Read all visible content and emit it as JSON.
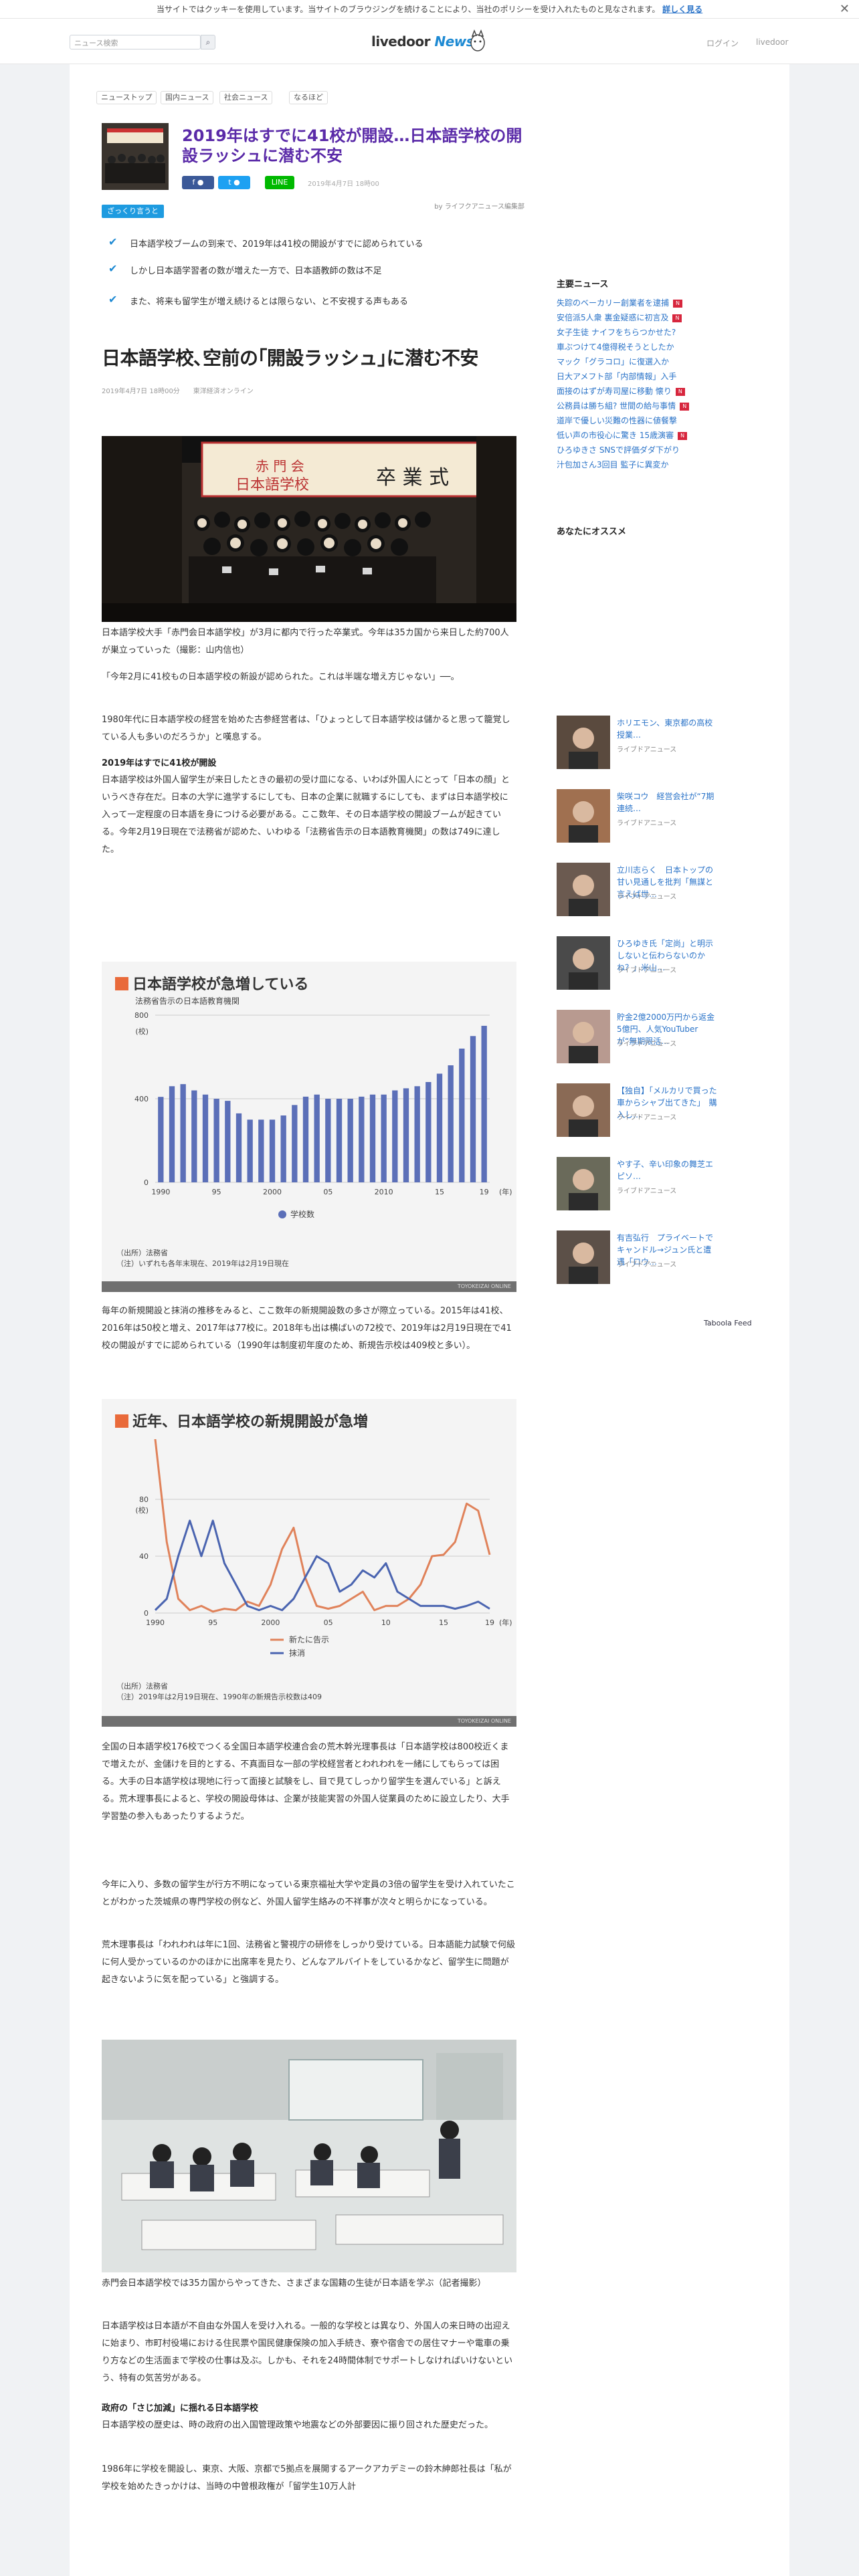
{
  "cookie": {
    "text": "当サイトではクッキーを使用しています。当サイトのブラウジングを続けることにより、当社のポリシーを受け入れたものと見なされます。",
    "link": "詳しく見る",
    "close": "✕"
  },
  "header": {
    "search_placeholder": "ニュース検索",
    "logo_main": "livedoor",
    "logo_sub": "News",
    "login": "ログイン",
    "livedoor": "livedoor"
  },
  "breadcrumb": [
    "ニューストップ",
    "国内ニュース",
    "社会ニュース",
    "なるほど"
  ],
  "article": {
    "title": "2019年はすでに41校が開設…日本語学校の開設ラッシュに潜む不安",
    "share": {
      "facebook": "f ●",
      "twitter": "t ●",
      "line": "LINE"
    },
    "date": "2019年4月7日 18時00",
    "byline": "by ライフクアニュース編集部",
    "tag": "ざっくり言うと",
    "points": [
      "日本語学校ブームの到来で、2019年は41校の開設がすでに認められている",
      "しかし日本語学習者の数が増えた一方で、日本語教師の数は不足",
      "また、将来も留学生が増え続けるとは限らない、と不安視する声もある"
    ],
    "heading": "日本語学校､空前の｢開設ラッシュ｣に潜む不安",
    "meta": "2019年4月7日 18時00分　　東洋経済オンライン",
    "photo1_caption": "日本語学校大手「赤門会日本語学校」が3月に都内で行った卒業式。今年は35カ国から来日した約700人が巣立っていった（撮影：山内信也）",
    "p1": "「今年2月に41校もの日本語学校の新設が認められた。これは半端な増え方じゃない」──。",
    "p2": "1980年代に日本語学校の経営を始めた古参経営者は、「ひょっとして日本語学校は儲かると思って籠覚している人も多いのだろうか」と嘆息する。",
    "sub1": "2019年はすでに41校が開設",
    "p3": "日本語学校は外国人留学生が来日したときの最初の受け皿になる、いわば外国人にとって「日本の顔」というべき存在だ。日本の大学に進学するにしても、日本の企業に就職するにしても、まずは日本語学校に入って一定程度の日本語を身につける必要がある。ここ数年、その日本語学校の開設ブームが起きている。今年2月19日現在で法務省が認めた、いわゆる「法務省告示の日本語教育機関」の数は749に達した。",
    "p4": "毎年の新規開設と抹消の推移をみると、ここ数年の新規開設数の多さが際立っている。2015年は41校、2016年は50校と増え、2017年は77校に。2018年も出は横ばいの72校で、2019年は2月19日現在で41校の開設がすでに認められている（1990年は制度初年度のため、新規告示校は409校と多い）。",
    "p5": "全国の日本語学校176校でつくる全国日本語学校連合会の荒木幹光理事長は「日本語学校は800校近くまで増えたが、金儲けを目的とする、不真面目な一部の学校経営者とわれわれを一緒にしてもらっては困る。大手の日本語学校は現地に行って面接と試験をし、目で見てしっかり留学生を選んでいる」と訴える。荒木理事長によると、学校の開設母体は、企業が技能実習の外国人従業員のために設立したり、大手学習塾の参入もあったりするようだ。",
    "p6": "今年に入り、多数の留学生が行方不明になっている東京福祉大学や定員の3倍の留学生を受け入れていたことがわかった茨城県の専門学校の例など、外国人留学生絡みの不祥事が次々と明らかになっている。",
    "p7": "荒木理事長は「われわれは年に1回、法務省と警視庁の研修をしっかり受けている。日本語能力試験で何級に何人受かっているのかのほかに出席率を見たり、どんなアルバイトをしているかなど、留学生に問題が起きないように気を配っている」と強調する。",
    "photo2_caption": "赤門会日本語学校では35カ国からやってきた、さまざまな国籍の生徒が日本語を学ぶ（記者撮影）",
    "p8": "日本語学校は日本語が不自由な外国人を受け入れる。一般的な学校とは異なり、外国人の来日時の出迎えに始まり、市町村役場における住民票や国民健康保険の加入手続き、寮や宿舎での居住マナーや電車の乗り方などの生活面まで学校の仕事は及ぶ。しかも、それを24時間体制でサポートしなければいけないという、特有の気苦労がある。",
    "sub2": "政府の「さじ加減」に揺れる日本語学校",
    "p9": "日本語学校の歴史は、時の政府の出入国管理政策や地震などの外部要因に振り回された歴史だった。",
    "p10": "1986年に学校を開設し、東京、大阪、京都で5拠点を展開するアークアカデミーの鈴木紳郎社長は「私が学校を始めたきっかけは、当時の中曽根政権が「留学生10万人計"
  },
  "photo1": {
    "banner_line1": "赤 門 会",
    "banner_line2": "日本語学校",
    "banner_line3": "卒 業 式"
  },
  "chart1": {
    "title": "日本語学校が急増している",
    "subtitle": "法務省告示の日本語教育機関",
    "y_unit": "(校)",
    "x_unit": "(年)",
    "legend": "学校数",
    "source": "（出所）法務省\n（注）いずれも各年末現在、2019年は2月19日現在",
    "foot": "TOYOKEIZAI ONLINE"
  },
  "chart2": {
    "title": "近年、日本語学校の新規開設が急増",
    "y_unit": "(校)",
    "x_unit": "(年)",
    "source": "（出所）法務省\n（注）2019年は2月19日現在、1990年の新規告示校数は409",
    "foot": "TOYOKEIZAI ONLINE"
  },
  "chart_data": [
    {
      "type": "bar",
      "title": "日本語学校が急増している",
      "subtitle": "法務省告示の日本語教育機関",
      "ylabel": "(校)",
      "xlabel": "(年)",
      "x_tick_labels": [
        "1990",
        "95",
        "2000",
        "05",
        "2010",
        "15",
        "19"
      ],
      "y_ticks": [
        0,
        400,
        800
      ],
      "ylim": [
        0,
        800
      ],
      "categories": [
        "1990",
        "1991",
        "1992",
        "1993",
        "1994",
        "1995",
        "1996",
        "1997",
        "1998",
        "1999",
        "2000",
        "2001",
        "2002",
        "2003",
        "2004",
        "2005",
        "2006",
        "2007",
        "2008",
        "2009",
        "2010",
        "2011",
        "2012",
        "2013",
        "2014",
        "2015",
        "2016",
        "2017",
        "2018",
        "2019"
      ],
      "series": [
        {
          "name": "学校数",
          "color": "#5b6fb8",
          "values": [
            409,
            460,
            470,
            440,
            420,
            400,
            390,
            330,
            300,
            300,
            300,
            320,
            370,
            410,
            420,
            400,
            400,
            400,
            410,
            420,
            420,
            440,
            450,
            460,
            480,
            520,
            560,
            640,
            700,
            749
          ]
        }
      ]
    },
    {
      "type": "line",
      "title": "近年、日本語学校の新規開設が急増",
      "ylabel": "(校)",
      "xlabel": "(年)",
      "x_tick_labels": [
        "1990",
        "95",
        "2000",
        "05",
        "10",
        "15",
        "19"
      ],
      "y_ticks": [
        0,
        40,
        80
      ],
      "ylim": [
        0,
        80
      ],
      "x": [
        "1990",
        "1991",
        "1992",
        "1993",
        "1994",
        "1995",
        "1996",
        "1997",
        "1998",
        "1999",
        "2000",
        "2001",
        "2002",
        "2003",
        "2004",
        "2005",
        "2006",
        "2007",
        "2008",
        "2009",
        "2010",
        "2011",
        "2012",
        "2013",
        "2014",
        "2015",
        "2016",
        "2017",
        "2018",
        "2019"
      ],
      "series": [
        {
          "name": "新たに告示",
          "color": "#e0825a",
          "values": [
            409,
            50,
            10,
            2,
            5,
            1,
            3,
            2,
            8,
            5,
            20,
            45,
            60,
            25,
            5,
            3,
            5,
            10,
            15,
            2,
            5,
            5,
            10,
            20,
            40,
            41,
            50,
            77,
            72,
            41
          ]
        },
        {
          "name": "抹消",
          "color": "#4a64b0",
          "values": [
            2,
            10,
            40,
            65,
            40,
            65,
            35,
            20,
            5,
            2,
            5,
            2,
            10,
            25,
            40,
            35,
            15,
            20,
            30,
            25,
            35,
            15,
            10,
            5,
            5,
            5,
            3,
            5,
            8,
            3
          ]
        }
      ]
    }
  ],
  "sidebar": {
    "main_news_heading": "主要ニュース",
    "main_news": [
      {
        "t": "失踪のベーカリー創業者を逮捕",
        "n": true
      },
      {
        "t": "安倍派5人衆 裏金疑惑に初言及",
        "n": true
      },
      {
        "t": "女子生徒 ナイフをちらつかせた?",
        "n": false
      },
      {
        "t": "車ぶつけて4億得税そうとしたか",
        "n": false
      },
      {
        "t": "マック「グラコロ」に復選入か",
        "n": false
      },
      {
        "t": "日大アメフト部「内部情報」入手",
        "n": false
      },
      {
        "t": "面接のはずが寿司屋に移動 懐り",
        "n": true
      },
      {
        "t": "公務員は勝ち組? 世間の給与事情",
        "n": true
      },
      {
        "t": "道岸で優しい災難の性器に値餐撃",
        "n": false
      },
      {
        "t": "低い声の市役心に驚き 15歳演審",
        "n": true
      },
      {
        "t": "ひろゆきさ SNSで評価ダダ下がり",
        "n": false
      },
      {
        "t": "汁包加さん3回目 監子に異変か",
        "n": false
      }
    ],
    "recommend_heading": "あなたにオススメ",
    "recommend": [
      {
        "t": "ホリエモン、東京都の高校授業…",
        "s": "ライブドアニュース"
      },
      {
        "t": "柴咲コウ　経営会社が“7期連続…",
        "s": "ライブドアニュース"
      },
      {
        "t": "立川志らく　日本トップの甘い見通しを批判「無謀と言えば世…",
        "s": "ライブドアニュース"
      },
      {
        "t": "ひろゆき氏「定尚」と明示しないと伝わらないのかね？」米山…",
        "s": "ライブドアニュース"
      },
      {
        "t": "貯金2億2000万円から返金5億円、人気YouTuberが“無期限活…",
        "s": "ライブドアニュース"
      },
      {
        "t": "【独自】「メルカリで買った車からシャブ出てきた」　購入し…",
        "s": "ライブドアニュース"
      },
      {
        "t": "やす子、辛い印象の舞芝エピソ…",
        "s": "ライブドアニュース"
      },
      {
        "t": "有吉弘行　プライベートでキャンドル→ジュン氏と遭遇「ロウ…",
        "s": "ライブドアニュース"
      }
    ],
    "taboola": "Taboola Feed"
  }
}
